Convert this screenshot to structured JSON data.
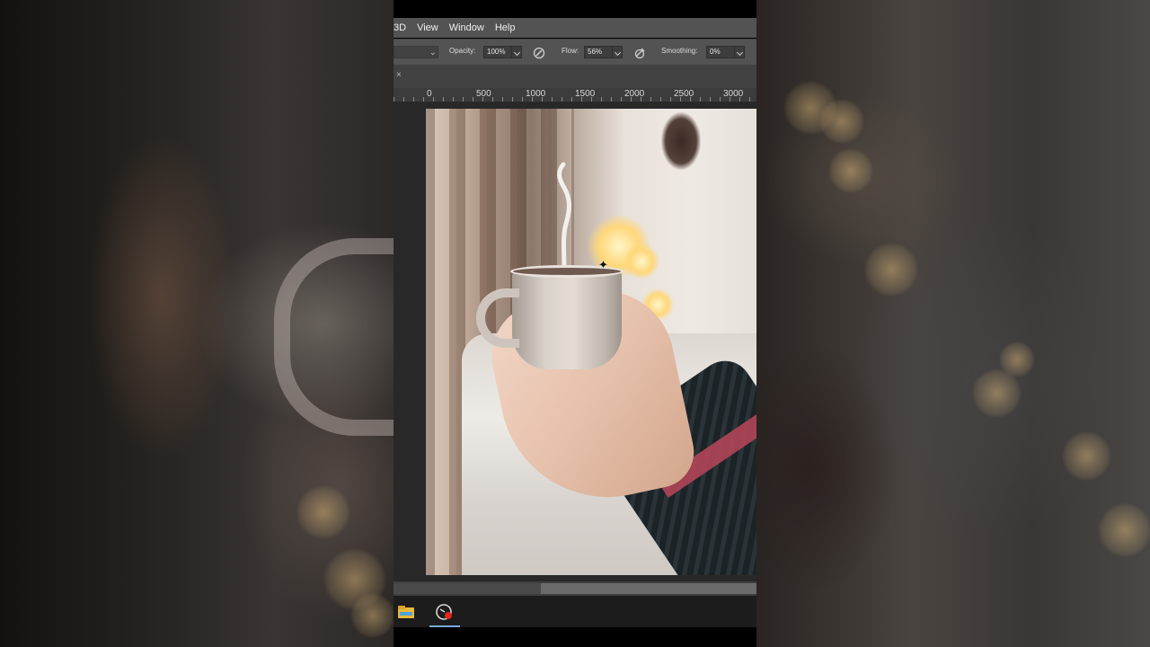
{
  "menubar": {
    "items": [
      "3D",
      "View",
      "Window",
      "Help"
    ]
  },
  "options_bar": {
    "opacity_label": "Opacity:",
    "opacity_value": "100%",
    "flow_label": "Flow:",
    "flow_value": "56%",
    "smoothing_label": "Smoothing:",
    "smoothing_value": "0%"
  },
  "tab": {
    "close_glyph": "×"
  },
  "ruler": {
    "labels": [
      "0",
      "500",
      "1000",
      "1500",
      "2000",
      "2500",
      "3000"
    ]
  },
  "canvas": {
    "image": "photo-hand-holding-mug-with-steam",
    "cursor_icon": "brush-crosshair-icon"
  },
  "taskbar": {
    "icons": [
      "file-explorer-icon",
      "photoshop-record-icon"
    ]
  },
  "colors": {
    "menubar_bg": "#535353",
    "canvas_bg": "#282828",
    "taskbar_bg": "#1c1c1c",
    "active_underline": "#79a9e0"
  }
}
